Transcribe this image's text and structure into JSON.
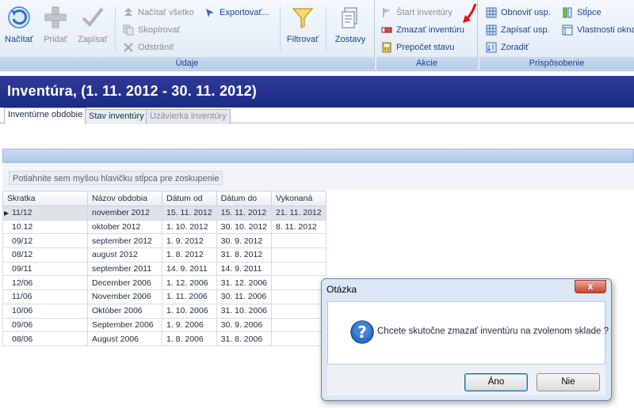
{
  "ribbon": {
    "udaje": {
      "label": "Údaje",
      "nacitat": "Načítať",
      "pridat": "Pridať",
      "zapisat": "Zapísať",
      "nacitat_vsetko": "Načítať všetko",
      "skopirovat": "Skopírovať",
      "odstranit": "Odstrániť",
      "exportovat": "Exportovať...",
      "filtrovat": "Filtrovať",
      "zostavy": "Zostavy"
    },
    "akcie": {
      "label": "Akcie",
      "start_inventury": "Štart inventúry",
      "zmazat_inventuru": "Zmazať inventúru",
      "prepocet_stavu": "Prepočet stavu"
    },
    "prisposobenie": {
      "label": "Prispôsobenie",
      "obnovit_usp": "Obnoviť usp.",
      "zapisat_usp": "Zapísať usp.",
      "zoradit": "Zoradiť",
      "stlpce": "Stĺpce",
      "vlastnosti_okna": "Vlastnosti okna"
    }
  },
  "title": "Inventúra,  (1. 11. 2012 - 30. 11. 2012)",
  "tabs": [
    {
      "label": "Inventúrne obdobie"
    },
    {
      "label": "Stav inventúry"
    },
    {
      "label": "Uzávierka inventúry"
    }
  ],
  "group_hint": "Potiahnite sem myšou hlavičku stĺpca pre zoskupenie",
  "grid": {
    "columns": [
      "Skratka",
      "Názov obdobia",
      "Dátum od",
      "Dátum do",
      "Vykonaná"
    ],
    "rows": [
      [
        "11/12",
        "november 2012",
        "15. 11. 2012",
        "15. 11. 2012",
        "21. 11. 2012"
      ],
      [
        "10.12",
        "oktober 2012",
        "1. 10. 2012",
        "30. 10. 2012",
        "8. 11. 2012"
      ],
      [
        "09/12",
        "september 2012",
        "1. 9. 2012",
        "30. 9. 2012",
        ""
      ],
      [
        "08/12",
        "august 2012",
        "1. 8. 2012",
        "31. 8. 2012",
        ""
      ],
      [
        "09/11",
        "september 2011",
        "14. 9. 2011",
        "14. 9. 2011",
        ""
      ],
      [
        "12/06",
        "December 2006",
        "1. 12. 2006",
        "31. 12. 2006",
        ""
      ],
      [
        "11/06",
        "November 2006",
        "1. 11. 2006",
        "30. 11. 2006",
        ""
      ],
      [
        "10/06",
        "Október 2006",
        "1. 10. 2006",
        "31. 10. 2006",
        ""
      ],
      [
        "09/06",
        "September 2006",
        "1. 9. 2006",
        "30. 9. 2006",
        ""
      ],
      [
        "08/06",
        "August 2006",
        "1. 8. 2006",
        "31. 8. 2006",
        ""
      ]
    ]
  },
  "dialog": {
    "title": "Otázka",
    "close": "x",
    "message": "Chcete skutočne zmazať inventúru na zvolenom sklade ?",
    "yes": "Áno",
    "no": "Nie"
  },
  "colors": {
    "title_bar": "#1c2a86",
    "ribbon_text": "#15428b",
    "close_button": "#c8452b"
  }
}
